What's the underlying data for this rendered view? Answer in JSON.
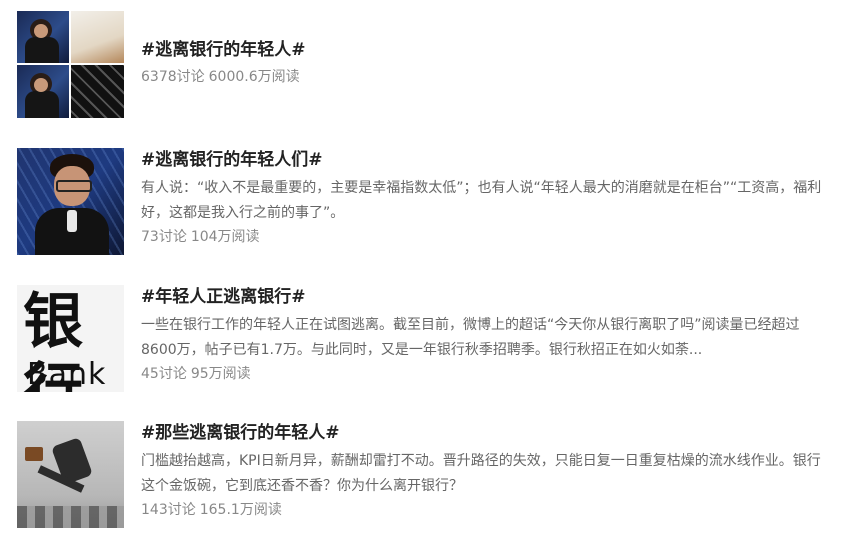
{
  "topics": [
    {
      "title": "#逃离银行的年轻人#",
      "description": "",
      "discussions": "6378讨论",
      "reads": "6000.6万阅读"
    },
    {
      "title": "#逃离银行的年轻人们#",
      "description": "有人说：“收入不是最重要的，主要是幸福指数太低”；也有人说“年轻人最大的消磨就是在柜台”“工资高，福利好，这都是我入行之前的事了”。",
      "discussions": "73讨论",
      "reads": "104万阅读"
    },
    {
      "title": "#年轻人正逃离银行#",
      "description": "一些在银行工作的年轻人正在试图逃离。截至目前，微博上的超话“今天你从银行离职了吗”阅读量已经超过8600万，帖子已有1.7万。与此同时，又是一年银行秋季招聘季。银行秋招正在如火如荼...",
      "discussions": "45讨论",
      "reads": "95万阅读"
    },
    {
      "title": "#那些逃离银行的年轻人#",
      "description": "门槛越抬越高，KPI日新月异，薪酬却雷打不动。晋升路径的失效，只能日复一日重复枯燥的流水线作业。银行这个金饭碗，它到底还香不香？你为什么离开银行？",
      "discussions": "143讨论",
      "reads": "165.1万阅读"
    }
  ]
}
